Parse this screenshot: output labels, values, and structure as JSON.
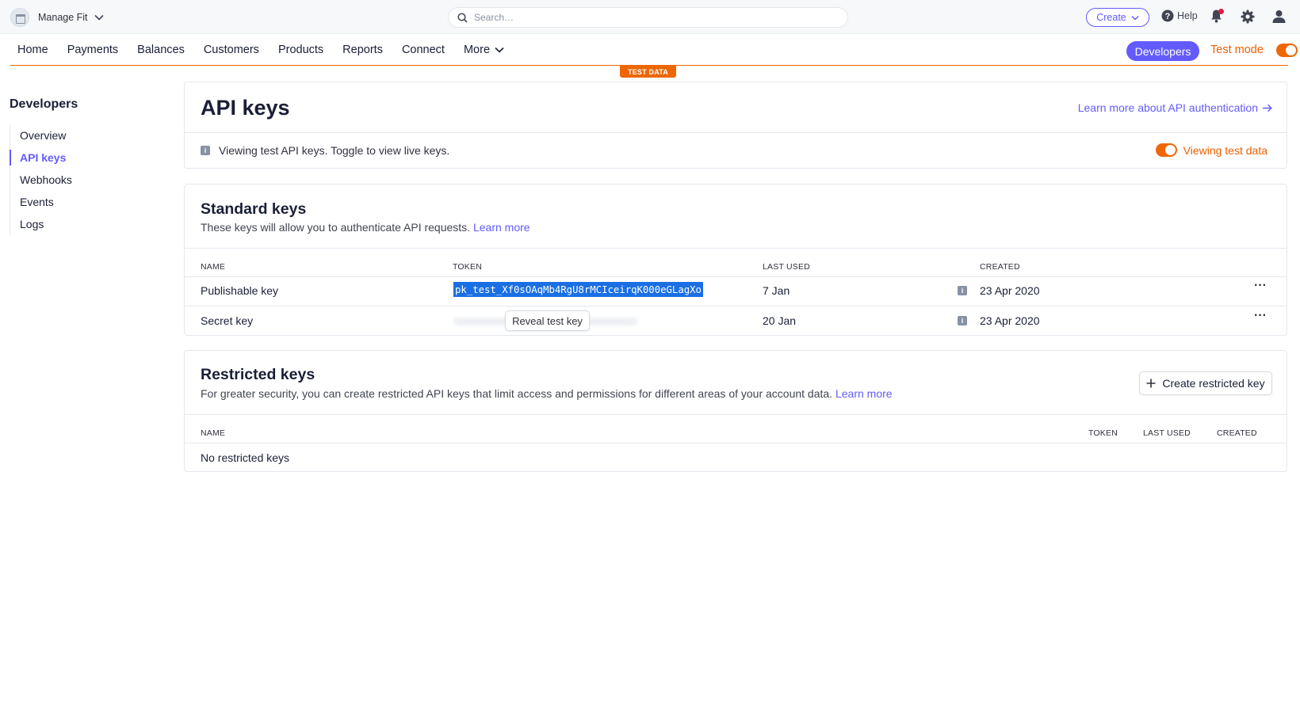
{
  "topbar": {
    "account_name": "Manage Fit",
    "search_placeholder": "Search…",
    "create_label": "Create",
    "help_label": "Help"
  },
  "nav": {
    "items": [
      "Home",
      "Payments",
      "Balances",
      "Customers",
      "Products",
      "Reports",
      "Connect",
      "More"
    ],
    "developers_label": "Developers",
    "test_mode_label": "Test mode",
    "test_data_badge": "TEST DATA"
  },
  "sidebar": {
    "title": "Developers",
    "items": [
      {
        "label": "Overview",
        "active": false
      },
      {
        "label": "API keys",
        "active": true
      },
      {
        "label": "Webhooks",
        "active": false
      },
      {
        "label": "Events",
        "active": false
      },
      {
        "label": "Logs",
        "active": false
      }
    ]
  },
  "header_card": {
    "title": "API keys",
    "learn_link": "Learn more about API authentication",
    "info_text": "Viewing test API keys. Toggle to view live keys.",
    "viewing_label": "Viewing test data"
  },
  "standard_keys": {
    "title": "Standard keys",
    "subtitle": "These keys will allow you to authenticate API requests.",
    "learn_more": "Learn more",
    "columns": {
      "name": "NAME",
      "token": "TOKEN",
      "last_used": "LAST USED",
      "created": "CREATED"
    },
    "rows": [
      {
        "name": "Publishable key",
        "token": "pk_test_Xf0sOAqMb4RgU8rMCIceirqK000eGLagXo",
        "last_used": "7 Jan",
        "created": "23 Apr 2020"
      },
      {
        "name": "Secret key",
        "reveal_label": "Reveal test key",
        "last_used": "20 Jan",
        "created": "23 Apr 2020"
      }
    ]
  },
  "restricted_keys": {
    "title": "Restricted keys",
    "subtitle": "For greater security, you can create restricted API keys that limit access and permissions for different areas of your account data.",
    "learn_more": "Learn more",
    "create_button": "Create restricted key",
    "columns": {
      "name": "NAME",
      "token": "TOKEN",
      "last_used": "LAST USED",
      "created": "CREATED"
    },
    "empty_text": "No restricted keys"
  },
  "colors": {
    "accent": "#635bff",
    "test_orange": "#ed6704",
    "selection_blue": "#1a6fe3"
  }
}
